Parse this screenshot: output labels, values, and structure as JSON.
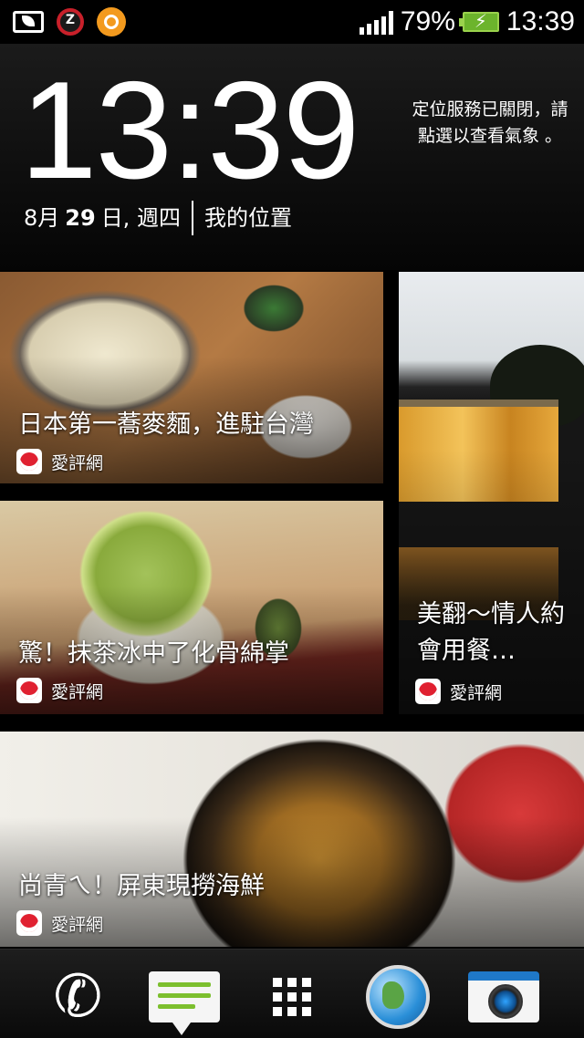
{
  "status_bar": {
    "icons": [
      "battery-saver-icon",
      "alarm-z-icon",
      "orange-app-icon",
      "signal-icon",
      "battery-charging-icon"
    ],
    "battery_percent": "79%",
    "time": "13:39"
  },
  "clock_widget": {
    "time": "13:39",
    "weather_message": "定位服務已關閉，請點選以查看氣象 。",
    "date_prefix": "8月",
    "date_day": "29",
    "date_suffix": "日, 週四",
    "location": "我的位置"
  },
  "feed": {
    "items": [
      {
        "title": "日本第一蕎麥麵，進駐台灣",
        "source": "愛評網"
      },
      {
        "title": "驚！抹茶冰中了化骨綿掌",
        "source": "愛評網"
      },
      {
        "title": "美翻～情人約會用餐…",
        "source": "愛評網"
      },
      {
        "title": "尚青ㄟ！屏東現撈海鮮",
        "source": "愛評網"
      }
    ]
  },
  "dock": {
    "items": [
      "phone-icon",
      "messages-icon",
      "all-apps-icon",
      "browser-icon",
      "camera-icon"
    ]
  },
  "colors": {
    "battery": "#6cb42c",
    "alarm": "#c8202a",
    "source_icon": "#e02030",
    "messages_lines": "#7cbf2e"
  }
}
